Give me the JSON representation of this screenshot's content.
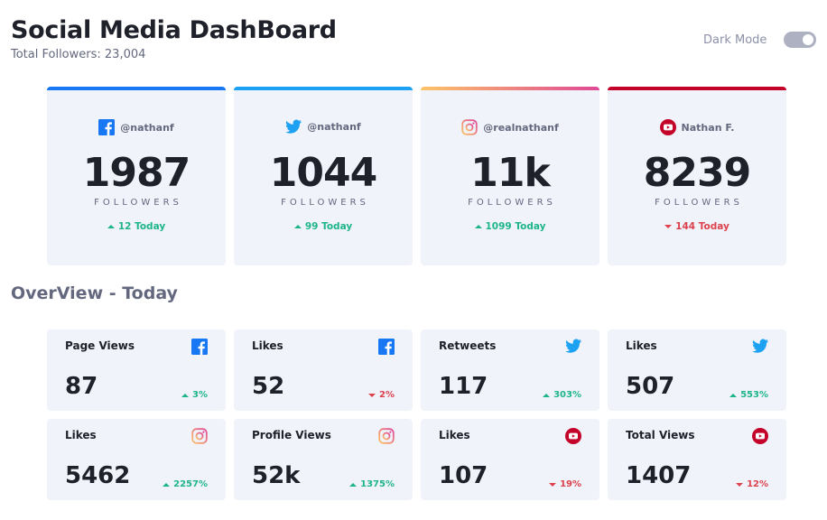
{
  "header": {
    "title": "Social Media DashBoard",
    "total_followers": "Total Followers: 23,004",
    "dark_mode_label": "Dark Mode",
    "dark_mode_on": false
  },
  "colors": {
    "facebook": "#1877f2",
    "twitter": "#1da1f2",
    "instagram_from": "#fdc468",
    "instagram_to": "#df4996",
    "youtube": "#c4032a",
    "up": "#1eb589",
    "down": "#dc414c"
  },
  "cards": [
    {
      "platform": "facebook",
      "icon": "facebook-icon",
      "handle": "@nathanf",
      "count": "1987",
      "label": "FOLLOWERS",
      "delta": "12 Today",
      "trend": "up"
    },
    {
      "platform": "twitter",
      "icon": "twitter-icon",
      "handle": "@nathanf",
      "count": "1044",
      "label": "FOLLOWERS",
      "delta": "99 Today",
      "trend": "up"
    },
    {
      "platform": "instagram",
      "icon": "instagram-icon",
      "handle": "@realnathanf",
      "count": "11k",
      "label": "FOLLOWERS",
      "delta": "1099 Today",
      "trend": "up"
    },
    {
      "platform": "youtube",
      "icon": "youtube-icon",
      "handle": "Nathan F.",
      "count": "8239",
      "label": "FOLLOWERS",
      "delta": "144 Today",
      "trend": "down"
    }
  ],
  "overview": {
    "title": "OverView - Today",
    "items": [
      {
        "label": "Page Views",
        "icon": "facebook-icon",
        "value": "87",
        "pct": "3%",
        "trend": "up"
      },
      {
        "label": "Likes",
        "icon": "facebook-icon",
        "value": "52",
        "pct": "2%",
        "trend": "down"
      },
      {
        "label": "Retweets",
        "icon": "twitter-icon",
        "value": "117",
        "pct": "303%",
        "trend": "up"
      },
      {
        "label": "Likes",
        "icon": "twitter-icon",
        "value": "507",
        "pct": "553%",
        "trend": "up"
      },
      {
        "label": "Likes",
        "icon": "instagram-icon",
        "value": "5462",
        "pct": "2257%",
        "trend": "up"
      },
      {
        "label": "Profile Views",
        "icon": "instagram-icon",
        "value": "52k",
        "pct": "1375%",
        "trend": "up"
      },
      {
        "label": "Likes",
        "icon": "youtube-icon",
        "value": "107",
        "pct": "19%",
        "trend": "down"
      },
      {
        "label": "Total Views",
        "icon": "youtube-icon",
        "value": "1407",
        "pct": "12%",
        "trend": "down"
      }
    ]
  }
}
